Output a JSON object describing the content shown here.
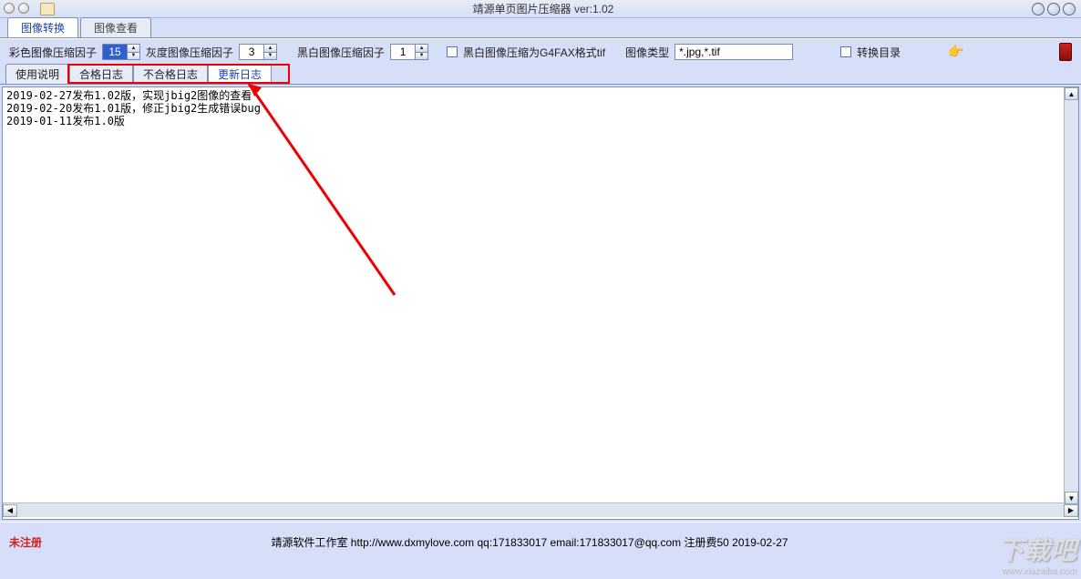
{
  "title": "靖源单页图片压缩器 ver:1.02",
  "main_tabs": {
    "convert": "图像转换",
    "view": "图像查看"
  },
  "toolbar": {
    "color_label": "彩色图像压缩因子",
    "color_value": "15",
    "gray_label": "灰度图像压缩因子",
    "gray_value": "3",
    "bw_label": "黑白图像压缩因子",
    "bw_value": "1",
    "bw_tif_label": "黑白图像压缩为G4FAX格式tif",
    "type_label": "图像类型",
    "type_value": "*.jpg,*.tif",
    "dir_label": "转换目录"
  },
  "sub_tabs": {
    "usage": "使用说明",
    "ok_log": "合格日志",
    "ng_log": "不合格日志",
    "update_log": "更新日志"
  },
  "log_lines": [
    "2019-02-27发布1.02版，实现jbig2图像的查看",
    "2019-02-20发布1.01版，修正jbig2生成错误bug",
    "2019-01-11发布1.0版"
  ],
  "status": {
    "unregistered": "未注册",
    "footer": "靖源软件工作室 http://www.dxmylove.com qq:171833017 email:171833017@qq.com 注册费50 2019-02-27"
  },
  "watermark": {
    "big": "下载吧",
    "small": "www.xiazaiba.com"
  }
}
